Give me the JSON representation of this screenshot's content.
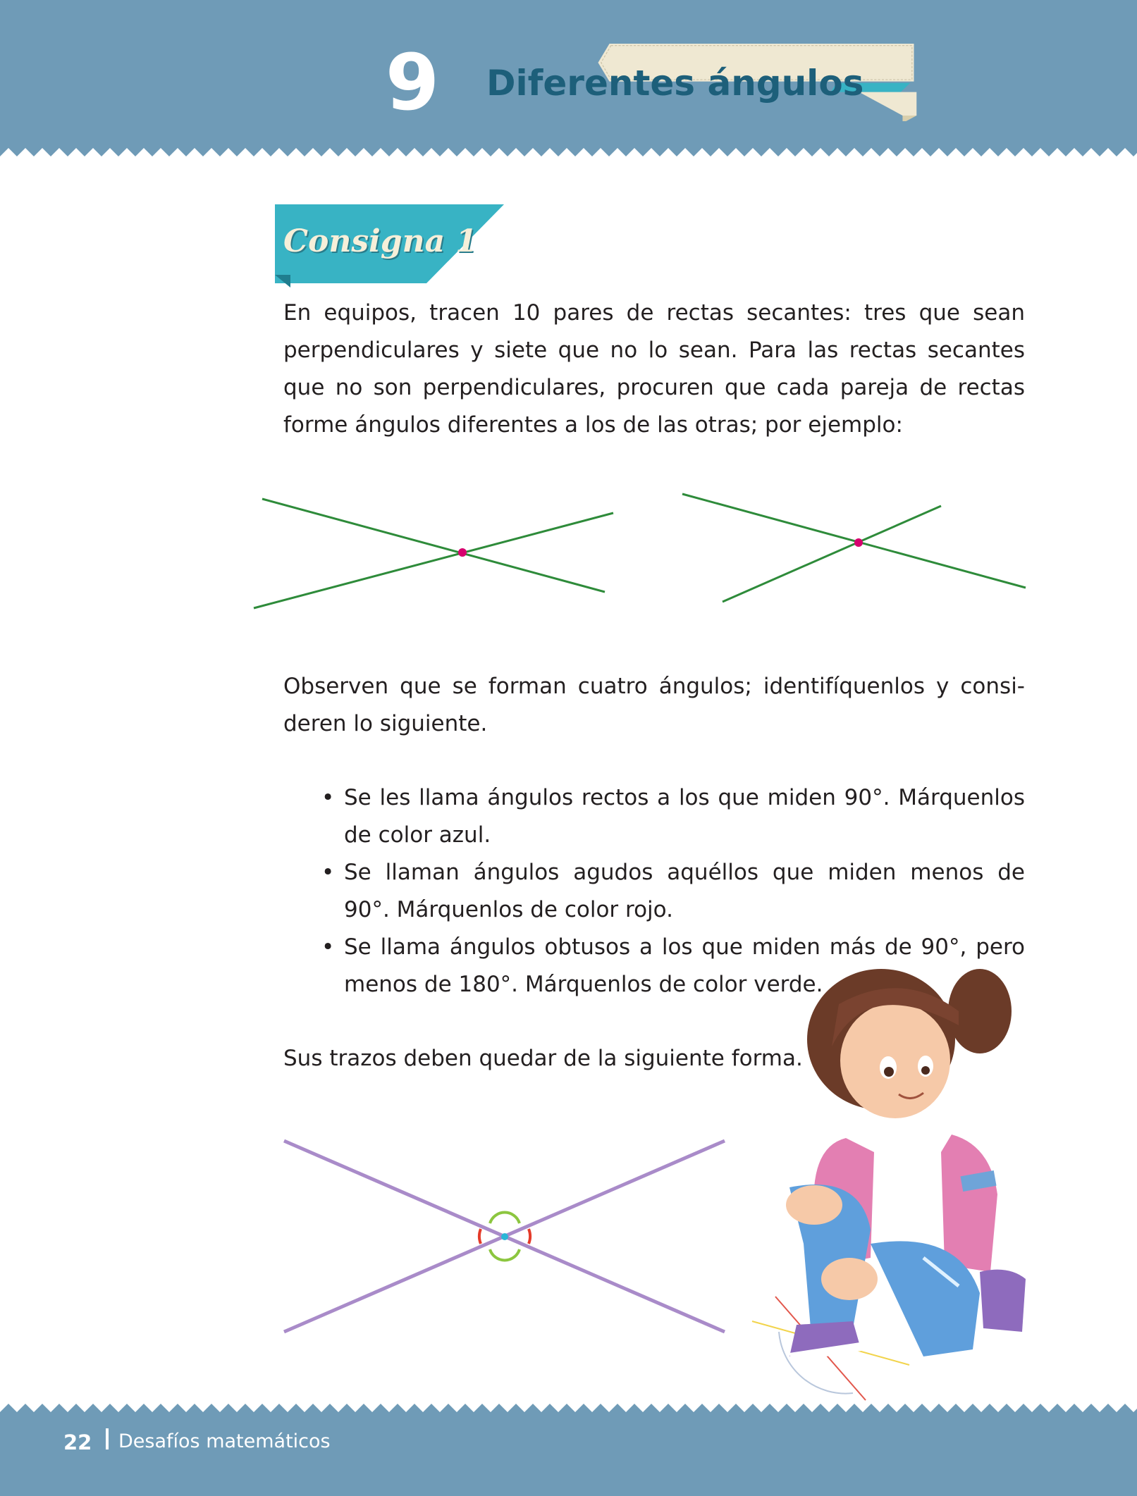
{
  "header": {
    "lesson_number": "9",
    "lesson_title": "Diferentes ángulos",
    "band_color": "#6f9bb7",
    "ribbon_color": "#efe8d2",
    "title_color": "#1d5f7a"
  },
  "consigna": {
    "label": "Consigna 1",
    "tag_color": "#38b3c4"
  },
  "intro": {
    "lines": [
      "En equipos, tracen 10 pares de rectas secantes: tres que sean",
      "perpendiculares y siete que no lo sean. Para las rectas secantes",
      "que no son perpendiculares, procuren que cada pareja de rectas",
      "forme ángulos diferentes a los de las otras; por ejemplo:"
    ]
  },
  "example_figures": {
    "line_color": "#2e8b3a",
    "intersection_color": "#d6006e"
  },
  "observe": {
    "lines": [
      "Observen que se forman cuatro ángulos; identifíquenlos y consi-",
      "deren lo siguiente."
    ]
  },
  "bullets": [
    {
      "lines": [
        "Se les llama ángulos rectos a los que miden 90°. Márquenlos",
        "de color azul."
      ]
    },
    {
      "lines": [
        "Se llaman ángulos agudos aquéllos que miden menos de",
        "90°. Márquenlos de color rojo."
      ]
    },
    {
      "lines": [
        "Se llama ángulos obtusos a los que miden más de 90°, pero",
        "menos de 180°. Márquenlos de color verde."
      ]
    }
  ],
  "bullet_symbol": "•",
  "closing": {
    "text": "Sus trazos deben quedar de la siguiente forma."
  },
  "result_figure": {
    "line_color": "#a98bc9",
    "acute_mark_color": "#e43b2a",
    "obtuse_mark_color": "#8cc63f",
    "intersection_color": "#29b6d6"
  },
  "illustration": {
    "icon": "girl-drawing-lines-illustration"
  },
  "footer": {
    "page_number": "22",
    "book_title": "Desafíos matemáticos"
  }
}
